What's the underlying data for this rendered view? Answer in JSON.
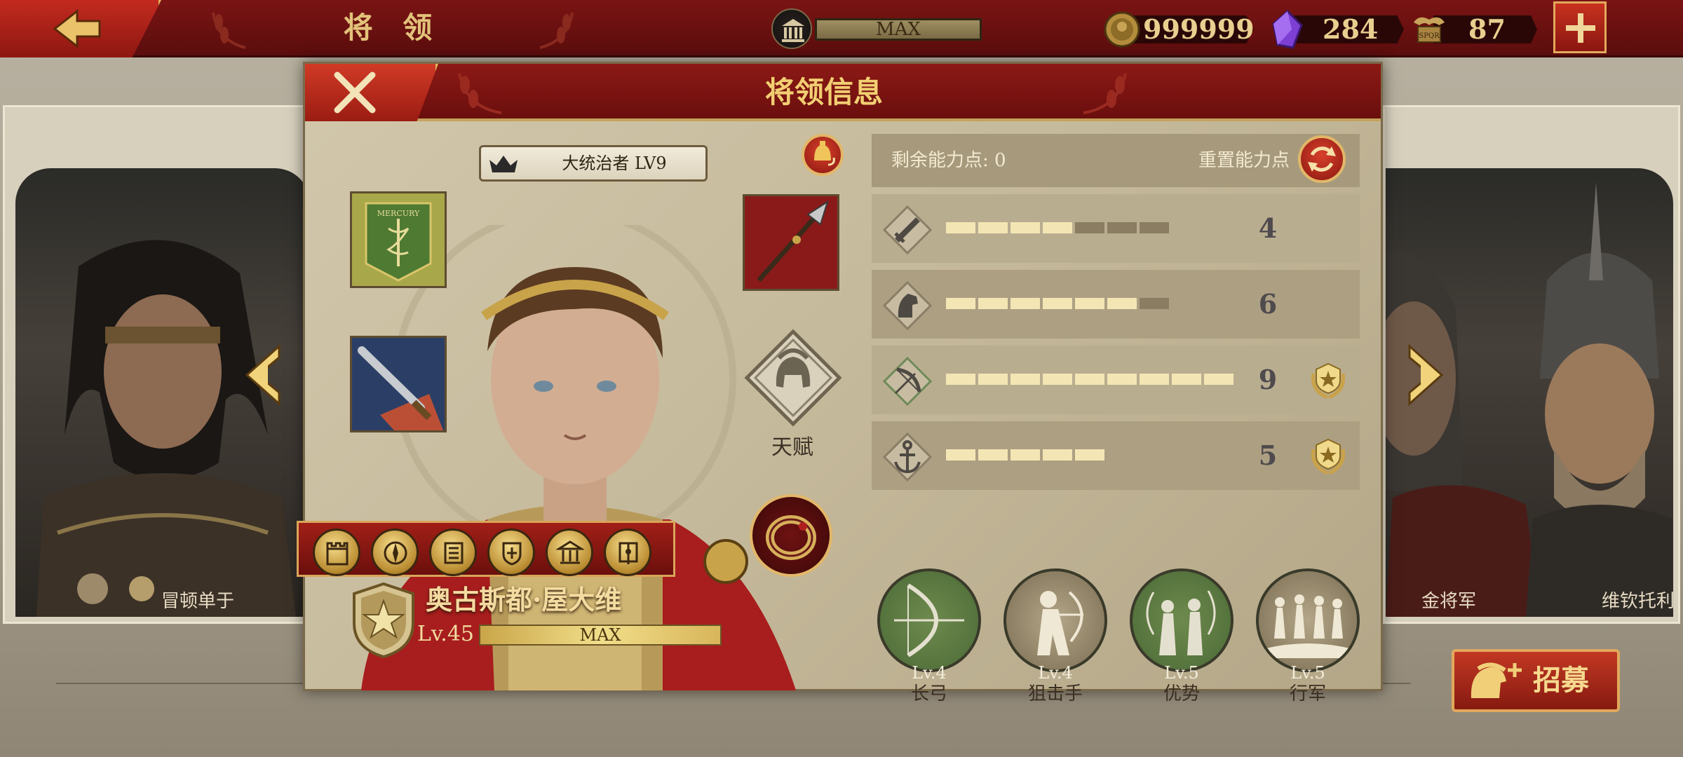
{
  "topbar": {
    "title": "将 领",
    "max_label": "MAX",
    "coins": "999999",
    "gems": "284",
    "spqr": "87",
    "spqr_icon_text": "SPQR"
  },
  "side_generals": {
    "left_name": "冒顿单于",
    "right_name_1": "金将军",
    "right_name_2": "维钦托利"
  },
  "dialog": {
    "title": "将领信息",
    "title_badge": "大统治者 LV9",
    "talent_label": "天赋",
    "banner_text": "MERCURY",
    "hero_name": "奥古斯都·屋大维",
    "hero_level": "Lv.45",
    "level_bar_label": "MAX",
    "level_progress": 1.0
  },
  "stats": {
    "remaining_label": "剩余能力点: 0",
    "reset_label": "重置能力点",
    "rows": [
      {
        "icon": "sword-icon",
        "value": "4",
        "filled": 4,
        "total": 7,
        "medal": false
      },
      {
        "icon": "horse-icon",
        "value": "6",
        "filled": 6,
        "total": 7,
        "medal": false
      },
      {
        "icon": "bow-icon",
        "value": "9",
        "filled": 9,
        "total": 9,
        "medal": true
      },
      {
        "icon": "anchor-icon",
        "value": "5",
        "filled": 5,
        "total": 5,
        "medal": true
      }
    ]
  },
  "unit_skills": [
    {
      "level": "Lv.4",
      "name": "长弓",
      "icon": "longbow-icon"
    },
    {
      "level": "Lv.4",
      "name": "狙击手",
      "icon": "sniper-archer-icon"
    },
    {
      "level": "Lv.5",
      "name": "优势",
      "icon": "advantage-archers-icon"
    },
    {
      "level": "Lv.5",
      "name": "行军",
      "icon": "march-troops-icon"
    }
  ],
  "recruit_label": "招募",
  "colors": {
    "header_red": "#7a1413",
    "gold": "#e0b35a",
    "parchment": "#c5b99b",
    "pip_on": "#f3e6b4",
    "pip_off": "#8a7d61"
  }
}
